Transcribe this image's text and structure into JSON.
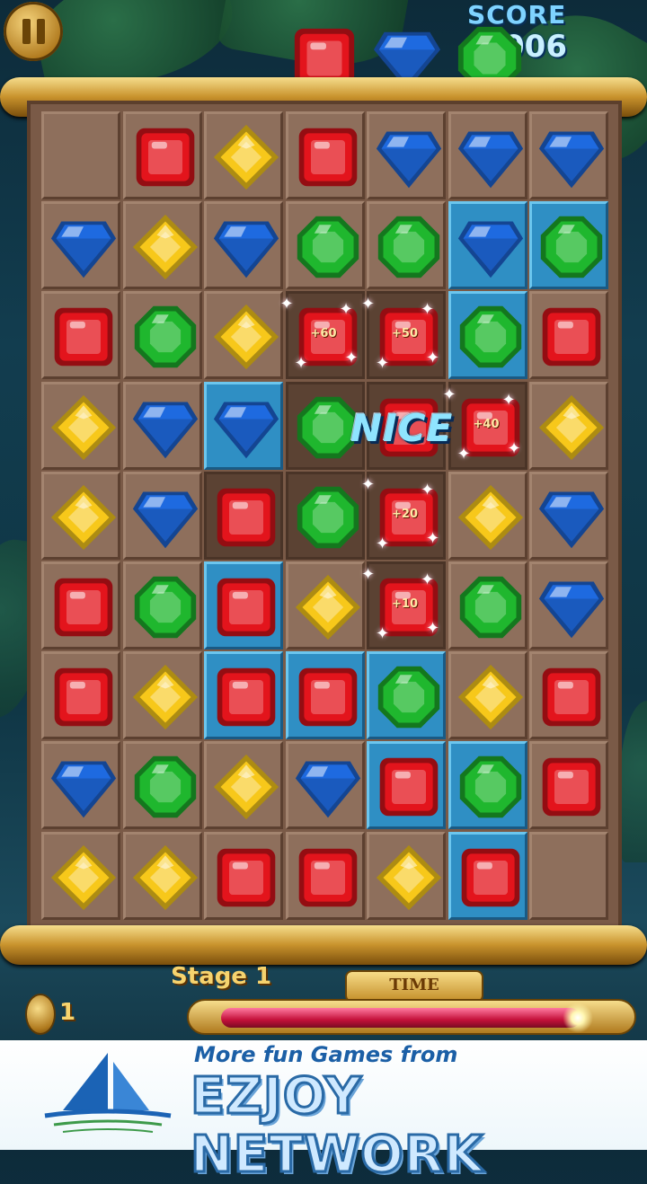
{
  "hud": {
    "score_label": "SCORE",
    "score_value": "006",
    "pause_icon": "pause-icon",
    "stage_label": "Stage 1",
    "time_label": "TIME",
    "time_remaining_fraction": 0.93,
    "coins": "1"
  },
  "preview_gems": [
    "red",
    "blue",
    "green"
  ],
  "gem_colors": {
    "red": "#e3141c",
    "yellow": "#f7c81a",
    "blue": "#1e6ae0",
    "green": "#1fb72e"
  },
  "board": {
    "rows": 9,
    "cols": 7,
    "cells": [
      [
        null,
        "red",
        "yellow",
        "red",
        "blue",
        "blue",
        "blue"
      ],
      [
        "blue",
        "yellow",
        "blue",
        "green",
        "green",
        "blue",
        "green"
      ],
      [
        "red",
        "green",
        "yellow",
        "red",
        "red",
        "green",
        "red"
      ],
      [
        "yellow",
        "blue",
        "blue",
        "green",
        "red",
        "red",
        "yellow"
      ],
      [
        "yellow",
        "blue",
        "red",
        "green",
        "red",
        "yellow",
        "blue"
      ],
      [
        "red",
        "green",
        "red",
        "yellow",
        "red",
        "green",
        "blue"
      ],
      [
        "red",
        "yellow",
        "red",
        "red",
        "green",
        "yellow",
        "red"
      ],
      [
        "blue",
        "green",
        "yellow",
        "blue",
        "red",
        "green",
        "red"
      ],
      [
        "yellow",
        "yellow",
        "red",
        "red",
        "yellow",
        "red",
        null
      ]
    ],
    "tile_styles": [
      [
        "plain",
        "plain",
        "plain",
        "plain",
        "plain",
        "plain",
        "plain"
      ],
      [
        "plain",
        "plain",
        "plain",
        "plain",
        "plain",
        "blue",
        "blue"
      ],
      [
        "plain",
        "plain",
        "plain",
        "dark",
        "dark",
        "blue",
        "plain"
      ],
      [
        "plain",
        "plain",
        "blue",
        "dark",
        "dark",
        "dark",
        "plain"
      ],
      [
        "plain",
        "plain",
        "dark",
        "dark",
        "dark",
        "plain",
        "plain"
      ],
      [
        "plain",
        "plain",
        "blue",
        "plain",
        "dark",
        "plain",
        "plain"
      ],
      [
        "plain",
        "plain",
        "blue",
        "blue",
        "blue",
        "plain",
        "plain"
      ],
      [
        "plain",
        "plain",
        "plain",
        "plain",
        "blue",
        "blue",
        "plain"
      ],
      [
        "plain",
        "plain",
        "plain",
        "plain",
        "plain",
        "blue",
        "plain"
      ]
    ],
    "point_popups": [
      {
        "row": 2,
        "col": 3,
        "text": "+60"
      },
      {
        "row": 2,
        "col": 4,
        "text": "+50"
      },
      {
        "row": 3,
        "col": 5,
        "text": "+40"
      },
      {
        "row": 4,
        "col": 4,
        "text": "+20"
      },
      {
        "row": 5,
        "col": 4,
        "text": "+10"
      }
    ],
    "combo_text": "NICE"
  },
  "banner": {
    "tagline": "More fun Games from",
    "brand": "EZJOY NETWORK",
    "logo_icon": "sailboat-icon"
  }
}
